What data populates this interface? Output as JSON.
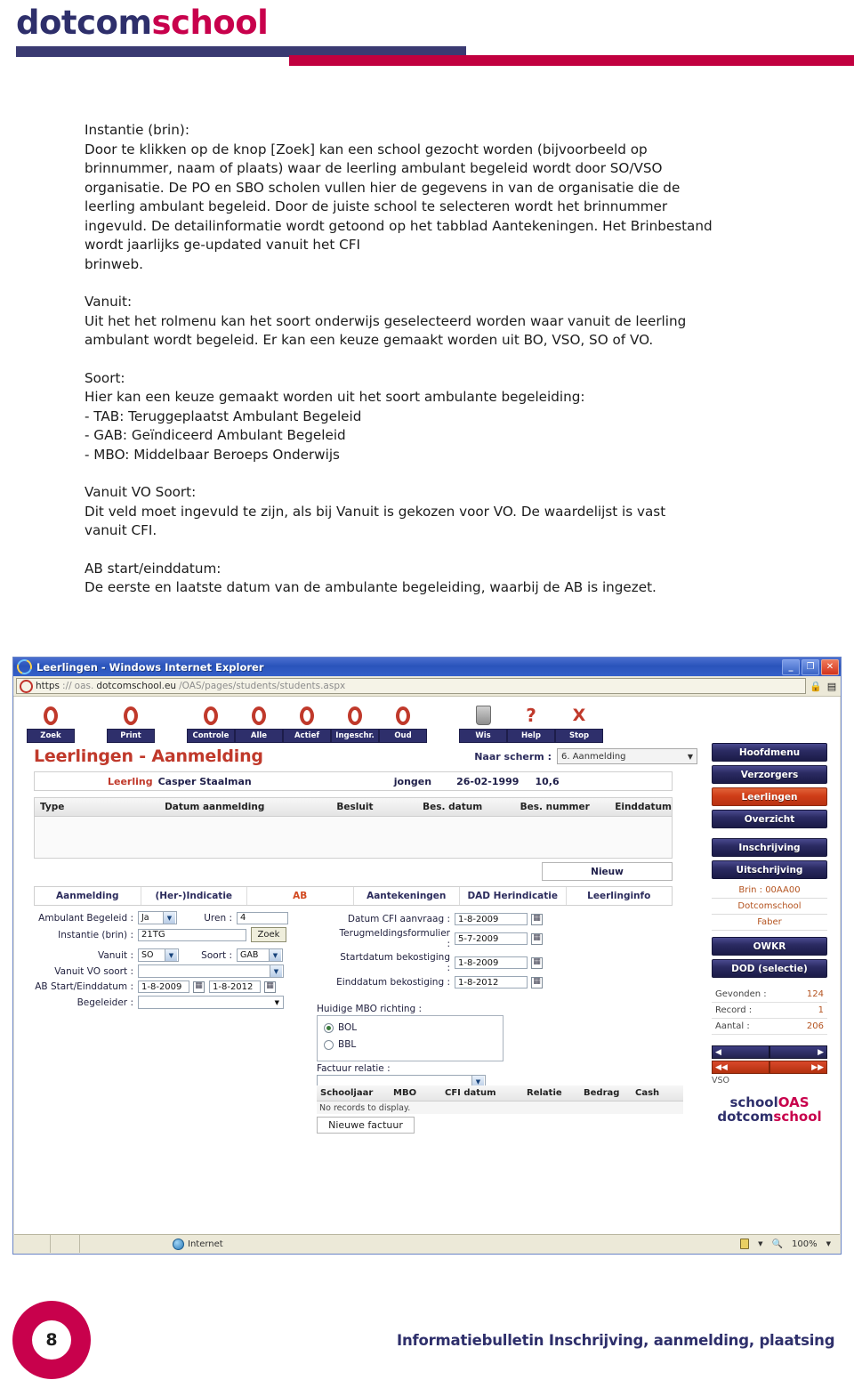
{
  "brand": {
    "part1": "dotcom",
    "part2": "school"
  },
  "colors": {
    "navy": "#2e2f6b",
    "crimson": "#c8014c",
    "accent_orange": "#d2491f",
    "title_red": "#c0392b"
  },
  "body_copy": {
    "sections": [
      {
        "heading": "Instantie (brin):",
        "lines": [
          "Door te klikken op de knop [Zoek] kan een school gezocht worden (bijvoorbeeld op",
          "brinnummer, naam of plaats) waar de leerling ambulant begeleid wordt door SO/VSO",
          "organisatie. De PO en SBO scholen vullen hier de gegevens in van de organisatie die de",
          "leerling ambulant begeleid. Door de juiste school te selecteren wordt het brinnummer",
          "ingevuld. De detailinformatie wordt getoond op het tabblad Aantekeningen. Het Brinbestand",
          "wordt jaarlijks ge-updated vanuit het CFI",
          "brinweb."
        ]
      },
      {
        "heading": "Vanuit:",
        "lines": [
          "Uit het het rolmenu kan het soort onderwijs geselecteerd worden waar vanuit de leerling",
          "ambulant wordt begeleid. Er kan een keuze gemaakt worden uit BO, VSO, SO of VO."
        ]
      },
      {
        "heading": "Soort:",
        "lines": [
          "Hier kan een keuze gemaakt worden uit het soort ambulante begeleiding:",
          "- TAB: Teruggeplaatst Ambulant Begeleid",
          "- GAB: Geïndiceerd Ambulant Begeleid",
          "- MBO: Middelbaar Beroeps Onderwijs"
        ]
      },
      {
        "heading": "Vanuit VO Soort:",
        "lines": [
          "Dit veld moet ingevuld te zijn, als bij Vanuit is gekozen voor VO. De waardelijst is vast",
          "vanuit CFI."
        ]
      },
      {
        "heading": "AB start/einddatum:",
        "lines": [
          "De eerste en laatste datum van de ambulante begeleiding, waarbij de AB is ingezet."
        ]
      }
    ]
  },
  "browser": {
    "title": "Leerlingen - Windows Internet Explorer",
    "ie_icon": "ie-logo-icon",
    "window_buttons": [
      {
        "name": "minimize-button",
        "glyph": "_"
      },
      {
        "name": "maximize-button",
        "glyph": "❐"
      },
      {
        "name": "close-button",
        "glyph": "✕"
      }
    ],
    "address": {
      "scheme": "https",
      "sep": "://",
      "host_dim": "oas.",
      "host": "dotcomschool.eu",
      "path": "/OAS/pages/students/students.aspx",
      "security_icon": "ssl-ring-icon",
      "lock_icon": "lock-icon",
      "refresh_icon": "page-icon"
    },
    "status": {
      "zone": "Internet",
      "zone_icon": "globe-icon",
      "protect_icon": "protected-mode-icon",
      "zoom": "100%",
      "zoom_icon": "magnifier-icon"
    }
  },
  "app": {
    "toolbar": [
      {
        "label": "Zoek",
        "icon": "ring-icon"
      },
      {
        "label": "Print",
        "icon": "ring-icon"
      },
      {
        "label": "Controle",
        "icon": "ring-icon"
      },
      {
        "label": "Alle",
        "icon": "ring-icon"
      },
      {
        "label": "Actief",
        "icon": "ring-icon"
      },
      {
        "label": "Ingeschr.",
        "icon": "ring-icon"
      },
      {
        "label": "Oud",
        "icon": "ring-icon"
      },
      {
        "label": "Wis",
        "icon": "trash-icon"
      },
      {
        "label": "Help",
        "icon": "question-mark-icon"
      },
      {
        "label": "Stop",
        "icon": "x-mark-icon"
      }
    ],
    "page_title": "Leerlingen - Aanmelding",
    "naar_scherm": {
      "label": "Naar scherm :",
      "value": "6. Aanmelding"
    },
    "student": {
      "label": "Leerling",
      "name": "Casper Staalman",
      "gender": "jongen",
      "birthdate": "26-02-1999",
      "age": "10,6"
    },
    "grid": {
      "columns": [
        "Type",
        "Datum aanmelding",
        "Besluit",
        "Bes. datum",
        "Bes. nummer",
        "Einddatum"
      ],
      "rows": [],
      "new_button": "Nieuw"
    },
    "tabs": [
      {
        "label": "Aanmelding",
        "active": false
      },
      {
        "label": "(Her-)Indicatie",
        "active": false
      },
      {
        "label": "AB",
        "active": true
      },
      {
        "label": "Aantekeningen",
        "active": false
      },
      {
        "label": "DAD Herindicatie",
        "active": false
      },
      {
        "label": "Leerlinginfo",
        "active": false
      }
    ],
    "form_left": {
      "ambulant_begeleid": {
        "label": "Ambulant Begeleid :",
        "value": "Ja"
      },
      "uren": {
        "label": "Uren :",
        "value": "4"
      },
      "instantie": {
        "label": "Instantie (brin) :",
        "value": "21TG",
        "button": "Zoek"
      },
      "vanuit": {
        "label": "Vanuit :",
        "value": "SO"
      },
      "soort": {
        "label": "Soort :",
        "value": "GAB"
      },
      "vanuit_vo_soort": {
        "label": "Vanuit VO soort :",
        "value": ""
      },
      "ab_start_eind": {
        "label": "AB Start/Einddatum :",
        "start": "1-8-2009",
        "end": "1-8-2012"
      },
      "begeleider": {
        "label": "Begeleider :",
        "value": ""
      }
    },
    "form_right": {
      "datum_cfi": {
        "label": "Datum CFI aanvraag :",
        "value": "1-8-2009"
      },
      "terugmelding": {
        "label": "Terugmeldingsformulier :",
        "value": "5-7-2009"
      },
      "startdatum_bekostiging": {
        "label": "Startdatum bekostiging :",
        "value": "1-8-2009"
      },
      "einddatum_bekostiging": {
        "label": "Einddatum bekostiging :",
        "value": "1-8-2012"
      }
    },
    "mbo": {
      "label": "Huidige MBO richting :",
      "options": [
        {
          "label": "BOL",
          "selected": true
        },
        {
          "label": "BBL",
          "selected": false
        }
      ],
      "factuur_relatie": {
        "label": "Factuur relatie :",
        "value": ""
      }
    },
    "factuur_grid": {
      "columns": [
        "Schooljaar",
        "MBO",
        "CFI datum",
        "Relatie",
        "Bedrag",
        "Cash"
      ],
      "empty_text": "No records to display.",
      "new_button": "Nieuwe factuur"
    },
    "sidebar": {
      "buttons_top": [
        {
          "label": "Hoofdmenu",
          "active": false
        },
        {
          "label": "Verzorgers",
          "active": false
        },
        {
          "label": "Leerlingen",
          "active": true
        },
        {
          "label": "Overzicht",
          "active": false
        }
      ],
      "buttons_mid": [
        {
          "label": "Inschrijving",
          "active": false
        },
        {
          "label": "Uitschrijving",
          "active": false
        }
      ],
      "info": [
        "Brin : 00AA00",
        "Dotcomschool",
        "Faber"
      ],
      "buttons_bottom": [
        {
          "label": "OWKR",
          "active": false
        },
        {
          "label": "DOD (selectie)",
          "active": false
        }
      ],
      "counts": [
        {
          "label": "Gevonden :",
          "value": "124"
        },
        {
          "label": "Record :",
          "value": "1"
        },
        {
          "label": "Aantal :",
          "value": "206"
        }
      ],
      "nav": {
        "prev_icon": "arrow-left-icon",
        "next_icon": "arrow-right-icon",
        "first_icon": "arrow-double-left-icon",
        "last_icon": "arrow-double-right-icon",
        "prev_glyph": "◀",
        "next_glyph": "▶",
        "first_glyph": "◀◀",
        "last_glyph": "▶▶"
      },
      "vso": "VSO",
      "logo": {
        "l1a": "school",
        "l1b": "OAS",
        "l2a": "dotcom",
        "l2b": "school"
      }
    }
  },
  "footer": {
    "page_number": "8",
    "text": "Informatiebulletin Inschrijving, aanmelding, plaatsing"
  }
}
